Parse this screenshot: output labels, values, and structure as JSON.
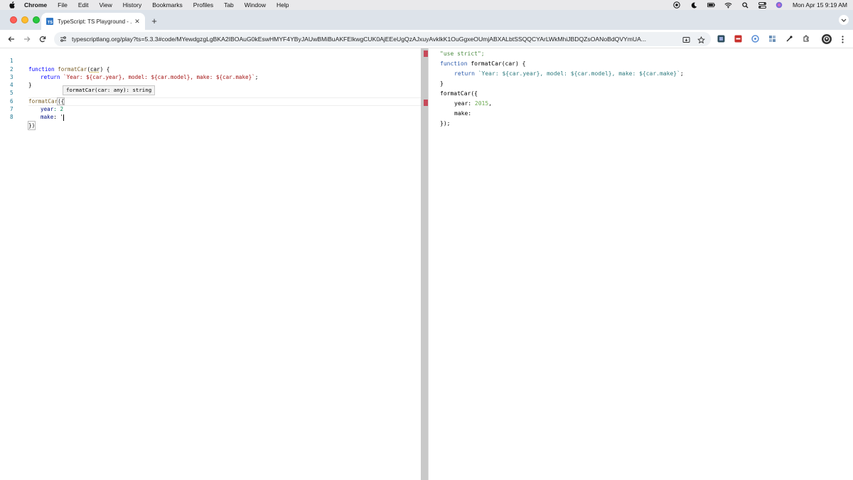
{
  "menubar": {
    "app": "Chrome",
    "items": [
      "File",
      "Edit",
      "View",
      "History",
      "Bookmarks",
      "Profiles",
      "Tab",
      "Window",
      "Help"
    ],
    "clock": "Mon Apr 15  9:19 AM"
  },
  "tabstrip": {
    "tab_title": "TypeScript: TS Playground - ...",
    "favicon_text": "TS"
  },
  "toolbar": {
    "url": "typescriptlang.org/play?ts=5.3.3#code/MYewdgzgLgBKA2IBOAuG0kEswHMYF4YByJAUwBMiBuAKFElkwgCUK0AjEEeUgQzAJxuyAvklkK1OuGgxeOUmjABXALbtSSQQCYArLWkMhiJBDQZsOANoBdQVYmUA..."
  },
  "editor": {
    "line_numbers": [
      "1",
      "2",
      "3",
      "4",
      "5",
      "6",
      "7",
      "8"
    ],
    "line1": {
      "kw": "function",
      "name": "formatCar",
      "param": "car",
      "rest": ") {"
    },
    "line2": {
      "kw": "return",
      "tmpl_a": "`Year: ${car.year}, model: ${car.model}, make: ${car.make}`",
      "end": ";"
    },
    "line3": "}",
    "line5": {
      "name": "formatCar",
      "open": "({"
    },
    "line6": {
      "prop": "year",
      "value": ": 2"
    },
    "line7": {
      "prop": "make",
      "value": ": '"
    },
    "line8": "})",
    "tooltip": "formatCar(car: any): string"
  },
  "output": {
    "l1": "\"use strict\";",
    "l2_kw": "function",
    "l2_rest": " formatCar(car) {",
    "l3_kw": "return",
    "l3_tmpl": "`Year: ${car.year}, model: ${car.model}, make: ${car.make}`",
    "l3_end": ";",
    "l4": "}",
    "l5": "formatCar({",
    "l6_prop": "year: ",
    "l6_num": "2015",
    "l6_end": ",",
    "l7": "make:",
    "l8": "});"
  }
}
